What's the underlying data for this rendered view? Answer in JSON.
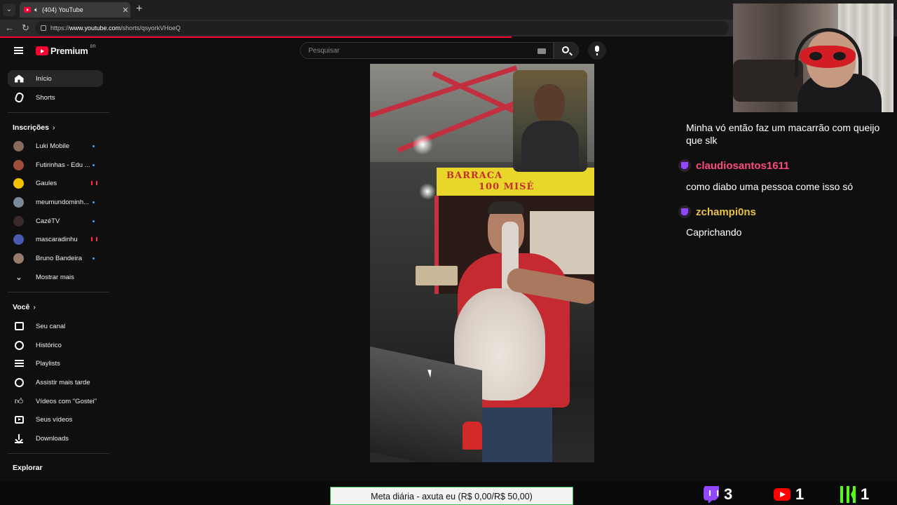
{
  "browser": {
    "tab_title": "(404) YouTube",
    "close_glyph": "✕",
    "new_tab_glyph": "+",
    "url_prefix": "https://",
    "url_host": "www.youtube.com",
    "url_path": "/shorts/qsyorkVHoeQ"
  },
  "youtube": {
    "brand": "Premium",
    "country_code": "BR",
    "search_placeholder": "Pesquisar",
    "sidebar": {
      "main": [
        {
          "label": "Início",
          "icon": "home-icon",
          "active": true
        },
        {
          "label": "Shorts",
          "icon": "shorts-icon"
        }
      ],
      "subscriptions_title": "Inscrições",
      "subscriptions": [
        {
          "label": "Luki Mobile",
          "indicator": "new",
          "avatar_color": "#8a6a5a"
        },
        {
          "label": "Futirinhas - Edu ...",
          "indicator": "new",
          "avatar_color": "#a0503a"
        },
        {
          "label": "Gaules",
          "indicator": "live",
          "avatar_color": "#f2c200"
        },
        {
          "label": "meumundominh...",
          "indicator": "new",
          "avatar_color": "#7a8a9a"
        },
        {
          "label": "CazéTV",
          "indicator": "new",
          "avatar_color": "#3a2a2a"
        },
        {
          "label": "mascaradinhu",
          "indicator": "live",
          "avatar_color": "#4a5ab0"
        },
        {
          "label": "Bruno Bandeira",
          "indicator": "new",
          "avatar_color": "#9a7a6a"
        }
      ],
      "show_more": "Mostrar mais",
      "you_title": "Você",
      "you_items": [
        {
          "label": "Seu canal",
          "icon": "channel-icon"
        },
        {
          "label": "Histórico",
          "icon": "history-icon"
        },
        {
          "label": "Playlists",
          "icon": "playlists-icon"
        },
        {
          "label": "Assistir mais tarde",
          "icon": "watch-later-icon"
        },
        {
          "label": "Vídeos com \"Gostei\"",
          "icon": "like-icon"
        },
        {
          "label": "Seus vídeos",
          "icon": "your-videos-icon"
        },
        {
          "label": "Downloads",
          "icon": "download-icon"
        }
      ],
      "explore_title": "Explorar"
    },
    "video_sign": {
      "line1": "BARRACA",
      "line2": "100 MISÉ"
    }
  },
  "chat": {
    "messages": [
      {
        "user": "",
        "text": "Minha vó então faz um macarrão com queijo que slk"
      },
      {
        "user": "claudiosantos1611",
        "user_color": "#ff4a7d",
        "text": "como diabo uma pessoa come isso só"
      },
      {
        "user": "zchampi0ns",
        "user_color": "#e8c04a",
        "text": "Caprichando"
      }
    ]
  },
  "overlay": {
    "goal_text": "Meta diária - axuta eu (R$ 0,00/R$ 50,00)",
    "twitch_count": "3",
    "youtube_count": "1",
    "kick_count": "1"
  }
}
